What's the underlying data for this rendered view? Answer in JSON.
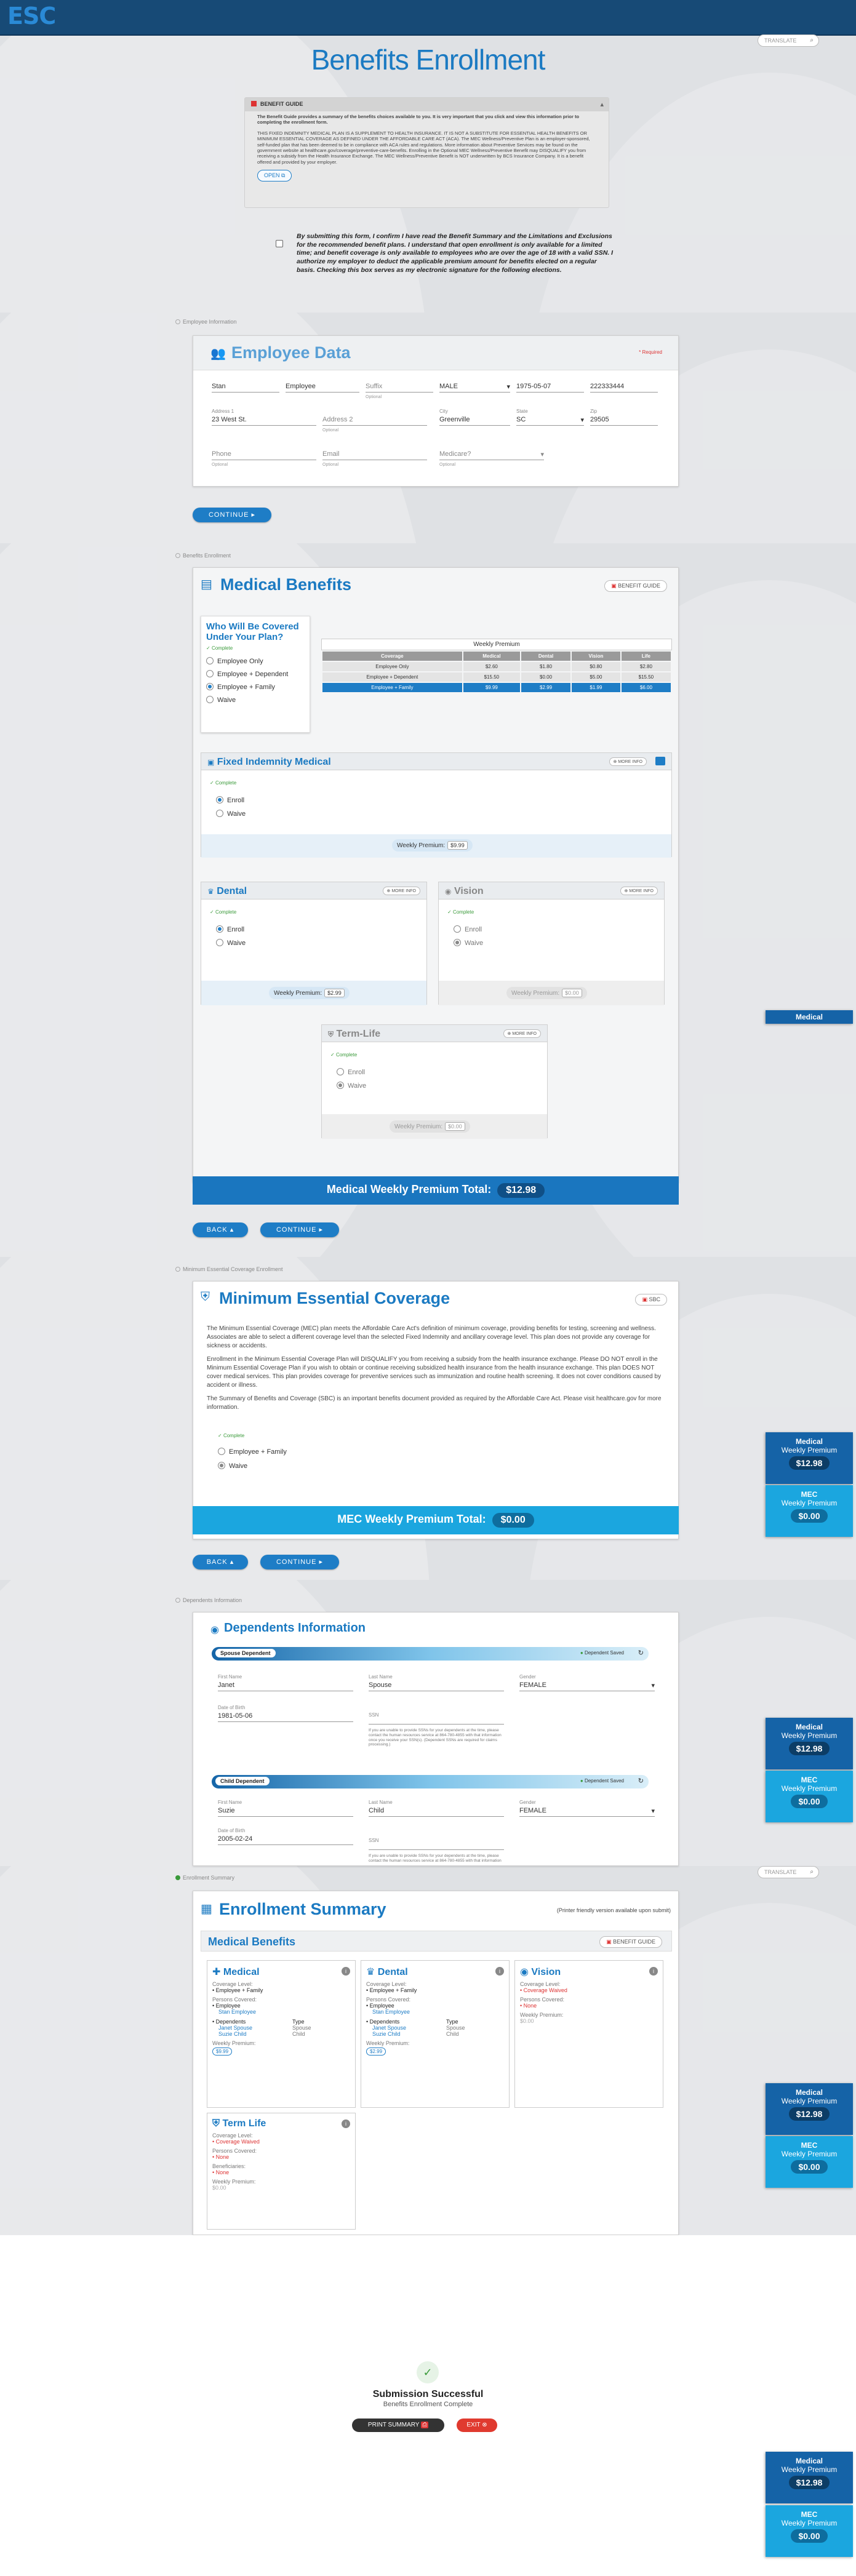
{
  "header": {
    "logo": "ESC",
    "translate_placeholder": "TRANSLATE"
  },
  "page_title": "Benefits Enrollment",
  "guide": {
    "title": "BENEFIT GUIDE",
    "intro": "The Benefit Guide provides a summary of the benefits choices available to you. It is very important that you click and view this information prior to completing the enrollment form.",
    "body": "THIS FIXED INDEMNITY MEDICAL PLAN IS A SUPPLEMENT TO HEALTH INSURANCE. IT IS NOT A SUBSTITUTE FOR ESSENTIAL HEALTH BENEFITS OR MINIMUM ESSENTIAL COVERAGE AS DEFINED UNDER THE AFFORDABLE CARE ACT (ACA). The MEC Wellness/Preventive Plan is an employer-sponsored, self-funded plan that has been deemed to be in compliance with ACA rules and regulations. More information about Preventive Services may be found on the government website at healthcare.gov/coverage/preventive-care-benefits. Enrolling in the Optional MEC Wellness/Preventive Benefit may DISQUALIFY you from receiving a subsidy from the Health Insurance Exchange. The MEC Wellness/Preventive Benefit is NOT underwritten by BCS Insurance Company. It is a benefit offered and provided by your employer.",
    "open_label": "OPEN"
  },
  "agreement": "By submitting this form, I confirm I have read the Benefit Summary and the Limitations and Exclusions for the recommended benefit plans. I understand that open enrollment is only available for a limited time; and benefit coverage is only available to employees who are over the age of 18 with a valid SSN. I authorize my employer to deduct the applicable premium amount for benefits elected on a regular basis. Checking this box serves as my electronic signature for the following elections.",
  "employee": {
    "section_tag": "Employee Information",
    "title": "Employee Data",
    "required": "* Required",
    "first": "Stan",
    "last": "Employee",
    "suffix_label": "Suffix",
    "optional": "Optional",
    "gender": "MALE",
    "dob": "1975-05-07",
    "ssn": "222333444",
    "address1_label": "Address 1",
    "address1": "23 West St.",
    "address2_label": "Address 2",
    "city_label": "City",
    "city": "Greenville",
    "state_label": "State",
    "state": "SC",
    "zip_label": "Zip",
    "zip": "29505",
    "phone_label": "Phone",
    "email_label": "Email",
    "medicare_label": "Medicare?",
    "continue": "CONTINUE"
  },
  "medical": {
    "section_tag": "Benefits Enrollment",
    "title": "Medical Benefits",
    "guide_btn": "BENEFIT GUIDE",
    "who_title": "Who Will Be Covered Under Your Plan?",
    "complete": "Complete",
    "options": [
      "Employee Only",
      "Employee + Dependent",
      "Employee + Family",
      "Waive"
    ],
    "table_caption": "Weekly Premium",
    "table_headers": [
      "Coverage",
      "Medical",
      "Dental",
      "Vision",
      "Life"
    ],
    "table_rows": [
      [
        "Employee Only",
        "$2.60",
        "$1.80",
        "$0.80",
        "$2.80"
      ],
      [
        "Employee + Dependent",
        "$15.50",
        "$0.00",
        "$5.00",
        "$15.50"
      ],
      [
        "Employee + Family",
        "$9.99",
        "$2.99",
        "$1.99",
        "$6.00"
      ]
    ],
    "fixed_title": "Fixed Indemnity Medical",
    "more_info": "MORE INFO",
    "enroll": "Enroll",
    "waive": "Waive",
    "weekly_label": "Weekly Premium:",
    "fixed_prem": "$9.99",
    "dental_title": "Dental",
    "dental_prem": "$2.99",
    "vision_title": "Vision",
    "vision_prem": "$0.00",
    "life_title": "Term-Life",
    "life_prem": "$0.00",
    "total_label": "Medical Weekly Premium Total:",
    "total": "$12.98",
    "back": "BACK",
    "continue": "CONTINUE"
  },
  "mec": {
    "section_tag": "Minimum Essential Coverage Enrollment",
    "title": "Minimum Essential Coverage",
    "tag": "SBC",
    "p1": "The Minimum Essential Coverage (MEC) plan meets the Affordable Care Act's definition of minimum coverage, providing benefits for testing, screening and wellness. Associates are able to select a different coverage level than the selected Fixed Indemnity and ancillary coverage level. This plan does not provide any coverage for sickness or accidents.",
    "p2": "Enrollment in the Minimum Essential Coverage Plan will DISQUALIFY you from receiving a subsidy from the health insurance exchange. Please DO NOT enroll in the Minimum Essential Coverage Plan if you wish to obtain or continue receiving subsidized health insurance from the health insurance exchange. This plan DOES NOT cover medical services. This plan provides coverage for preventive services such as immunization and routine health screening. It does not cover conditions caused by accident or illness.",
    "p3": "The Summary of Benefits and Coverage (SBC) is an important benefits document provided as required by the Affordable Care Act. Please visit healthcare.gov for more information.",
    "complete": "Complete",
    "options": [
      "Employee + Family",
      "Waive"
    ],
    "total_label": "MEC Weekly Premium Total:",
    "total": "$0.00",
    "back": "BACK",
    "continue": "CONTINUE"
  },
  "dependents": {
    "section_tag": "Dependents Information",
    "title": "Dependents Information",
    "saved": "Dependent Saved",
    "first_label": "First Name",
    "last_label": "Last Name",
    "gender_label": "Gender",
    "dob_label": "Date of Birth",
    "ssn_label": "SSN",
    "ssn_note": "If you are unable to provide SSNs for your dependents at the time, please contact the human resources service at 864-780-4855 with that information once you receive your SSN(s). (Dependent SSNs are required for claims processing.)",
    "spouse": {
      "tag": "Spouse Dependent",
      "first": "Janet",
      "last": "Spouse",
      "gender": "FEMALE",
      "dob": "1981-05-06"
    },
    "child": {
      "tag": "Child Dependent",
      "first": "Suzie",
      "last": "Child",
      "gender": "FEMALE",
      "dob": "2005-02-24"
    }
  },
  "summary": {
    "section_tag": "Enrollment Summary",
    "title": "Enrollment Summary",
    "printer": "(Printer friendly version available upon submit)",
    "sub_title": "Medical Benefits",
    "guide_btn": "BENEFIT GUIDE",
    "coverage_level": "Coverage Level:",
    "persons_covered": "Persons Covered:",
    "dependents_label": "Dependents",
    "type_label": "Type",
    "weekly_label": "Weekly Premium:",
    "beneficiaries": "Beneficiaries:",
    "employee_label": "Employee",
    "employee_name": "Stan Employee",
    "deps": [
      {
        "name": "Janet Spouse",
        "type": "Spouse"
      },
      {
        "name": "Suzie Child",
        "type": "Child"
      }
    ],
    "medical": {
      "title": "Medical",
      "level": "Employee + Family",
      "prem": "$9.99"
    },
    "dental": {
      "title": "Dental",
      "level": "Employee + Family",
      "prem": "$2.99"
    },
    "vision": {
      "title": "Vision",
      "level": "Coverage Waived",
      "covered": "None",
      "prem": "$0.00"
    },
    "life": {
      "title": "Term Life",
      "level": "Coverage Waived",
      "covered": "None",
      "beneficiaries": "None",
      "prem": "$0.00"
    }
  },
  "success": {
    "title": "Submission Successful",
    "subtitle": "Benefits Enrollment Complete",
    "print": "PRINT SUMMARY",
    "exit": "EXIT"
  },
  "side": {
    "medical": "Medical",
    "mec": "MEC",
    "weekly": "Weekly Premium",
    "medical_amt": "$12.98",
    "mec_amt": "$0.00"
  },
  "colors": {
    "brand": "#1b7ac2",
    "header": "#174a76",
    "total_bar": "#1a76bf",
    "mec_bar": "#1ba6df",
    "success": "#3a9a3a"
  }
}
